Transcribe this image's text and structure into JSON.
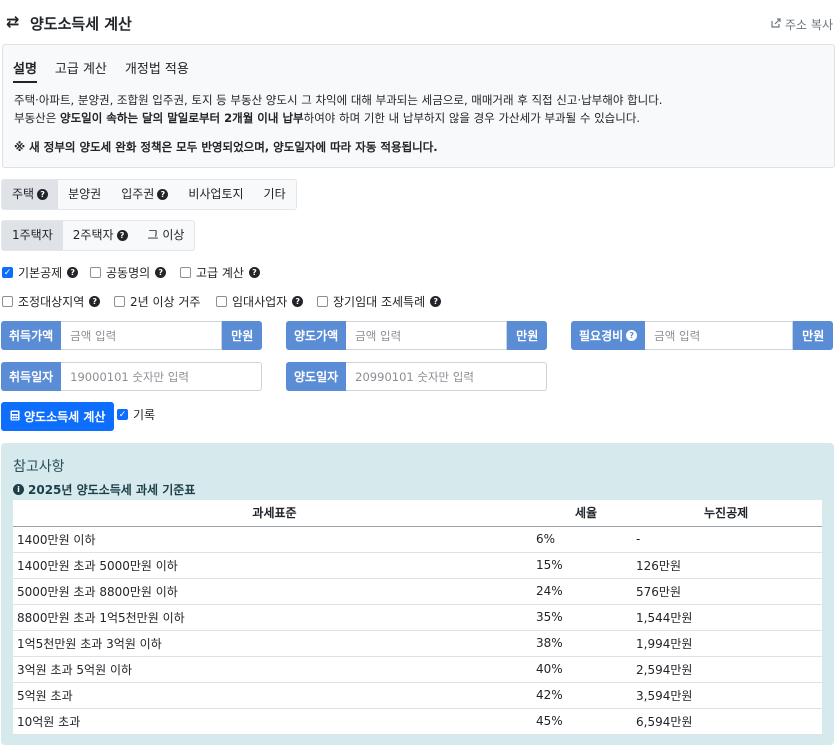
{
  "header": {
    "icon": "swap-arrows-icon",
    "title": "양도소득세 계산",
    "share_label": "주소 복사"
  },
  "info": {
    "tabs": [
      "설명",
      "고급 계산",
      "개정법 적용"
    ],
    "para1": "주택·아파트, 분양권, 조합원 입주권, 토지 등 부동산 양도시 그 차익에 대해 부과되는 세금으로, 매매거래 후 직접 신고·납부해야 합니다.",
    "para2_pre": "부동산은 ",
    "para2_bold": "양도일이 속하는 달의 말일로부터 2개월 이내 납부",
    "para2_post": "하여야 하며 기한 내 납부하지 않을 경우 가산세가 부과될 수 있습니다.",
    "note": "※ 새 정부의 양도세 완화 정책은 모두 반영되었으며, 양도일자에 따라 자동 적용됩니다."
  },
  "asset_tabs": [
    "주택",
    "분양권",
    "입주권",
    "비사업토지",
    "기타"
  ],
  "owner_tabs": [
    "1주택자",
    "2주택자",
    "그 이상"
  ],
  "options_row1": [
    {
      "label": "기본공제",
      "checked": true
    },
    {
      "label": "공동명의",
      "checked": false
    },
    {
      "label": "고급 계산",
      "checked": false
    }
  ],
  "options_row2": [
    {
      "label": "조정대상지역",
      "checked": false
    },
    {
      "label": "2년 이상 거주",
      "checked": false
    },
    {
      "label": "임대사업자",
      "checked": false
    },
    {
      "label": "장기임대 조세특례",
      "checked": false
    }
  ],
  "inputs": {
    "acquire_price": {
      "label": "취득가액",
      "placeholder": "금액 입력",
      "unit": "만원"
    },
    "sale_price": {
      "label": "양도가액",
      "placeholder": "금액 입력",
      "unit": "만원"
    },
    "expense": {
      "label": "필요경비",
      "placeholder": "금액 입력",
      "unit": "만원"
    },
    "acquire_date": {
      "label": "취득일자",
      "placeholder": "19000101 숫자만 입력"
    },
    "sale_date": {
      "label": "양도일자",
      "placeholder": "20990101 숫자만 입력"
    }
  },
  "calc_button": "양도소득세 계산",
  "record_label": "기록",
  "reference": {
    "title": "참고사항",
    "subtitle": "2025년 양도소득세 과세 기준표",
    "columns": [
      "과세표준",
      "세율",
      "누진공제"
    ],
    "rows": [
      [
        "1400만원 이하",
        "6%",
        "-"
      ],
      [
        "1400만원 초과 5000만원 이하",
        "15%",
        "126만원"
      ],
      [
        "5000만원 초과 8800만원 이하",
        "24%",
        "576만원"
      ],
      [
        "8800만원 초과 1억5천만원 이하",
        "35%",
        "1,544만원"
      ],
      [
        "1억5천만원 초과 3억원 이하",
        "38%",
        "1,994만원"
      ],
      [
        "3억원 초과 5억원 이하",
        "40%",
        "2,594만원"
      ],
      [
        "5억원 초과",
        "42%",
        "3,594만원"
      ],
      [
        "10억원 초과",
        "45%",
        "6,594만원"
      ]
    ]
  }
}
